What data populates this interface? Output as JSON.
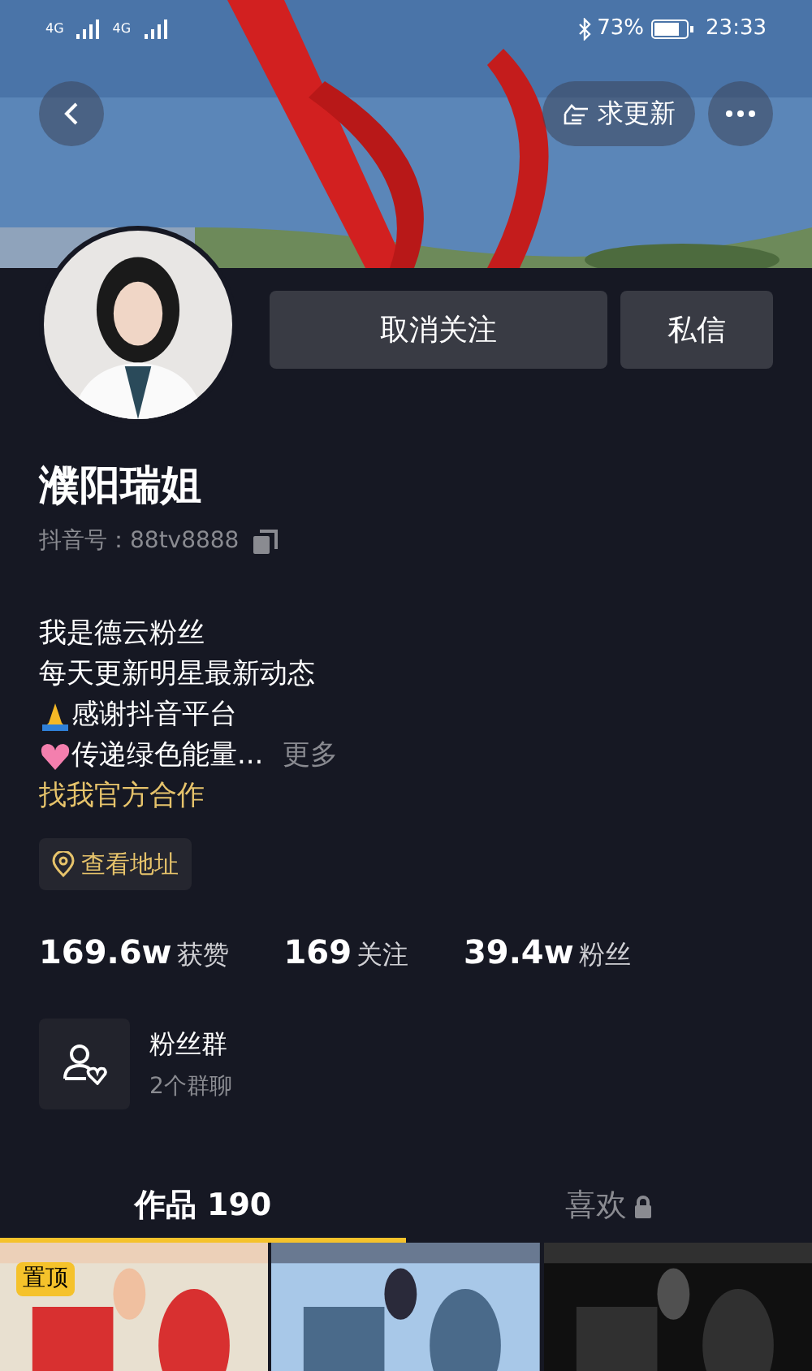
{
  "status_bar": {
    "network_1": "4G",
    "network_2": "4G",
    "battery": "73%",
    "time": "23:33"
  },
  "header": {
    "request_update_button": "求更新"
  },
  "profile": {
    "name": "濮阳瑞姐",
    "douyin_id": "抖音号：88tv8888",
    "follow_button": "取消关注",
    "message_button": "私信"
  },
  "bio": [
    {
      "kind": "plain",
      "text": "我是德云粉丝"
    },
    {
      "kind": "plain",
      "text": "每天更新明星最新动态"
    },
    {
      "kind": "pray",
      "text": "感谢抖音平台"
    },
    {
      "kind": "heart",
      "text": "传递绿色能量...",
      "more": "更多"
    }
  ],
  "cooperation_link": "找我官方合作",
  "address_button": "查看地址",
  "stats": [
    {
      "value": "169.6w",
      "label": "获赞"
    },
    {
      "value": "169",
      "label": "关注"
    },
    {
      "value": "39.4w",
      "label": "粉丝"
    }
  ],
  "fan_group": {
    "title": "粉丝群",
    "subtitle": "2个群聊"
  },
  "tabs": [
    {
      "label": "作品 190",
      "selected": true,
      "locked": false
    },
    {
      "label": "喜欢",
      "selected": false,
      "locked": true
    }
  ],
  "videos": [
    {
      "kind": "picture",
      "badge": "置顶"
    },
    {
      "kind": "picture"
    },
    {
      "kind": "picture"
    }
  ]
}
